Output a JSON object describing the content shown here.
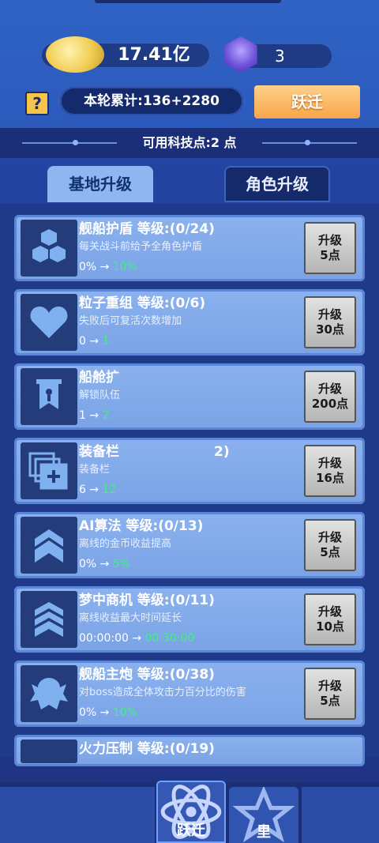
{
  "header": {
    "gold_value": "17.41亿",
    "gem_value": "3",
    "help_icon": "?",
    "round_total": "本轮累计:136+2280",
    "jump_button": "跃迁"
  },
  "tech": {
    "available_points": "可用科技点:2 点"
  },
  "tabs": [
    {
      "label": "基地升级",
      "active": true
    },
    {
      "label": "角色升级",
      "active": false
    }
  ],
  "upgrades": [
    {
      "icon": "hexagon-cluster-icon",
      "title": "舰船护盾  等级:(0/24)",
      "desc": "每关战斗前给予全角色护盾",
      "from": "0%",
      "to": "10%",
      "btn_top": "升级",
      "btn_cost": "5点"
    },
    {
      "icon": "heart-icon",
      "title": "粒子重组  等级:(0/6)",
      "desc": "失败后可复活次数增加",
      "from": "0",
      "to": "1",
      "btn_top": "升级",
      "btn_cost": "30点"
    },
    {
      "icon": "banner-icon",
      "title": "船舱扩",
      "desc": "解锁队伍",
      "from": "1",
      "to": "2",
      "btn_top": "升级",
      "btn_cost": "200点"
    },
    {
      "icon": "stacked-cards-plus-icon",
      "title": "装备栏",
      "title_tail": "2)",
      "desc": "装备栏",
      "from": "6",
      "to": "12",
      "btn_top": "升级",
      "btn_cost": "16点"
    },
    {
      "icon": "double-chevron-icon",
      "title": "AI算法  等级:(0/13)",
      "desc": "离线的金币收益提高",
      "from": "0%",
      "to": "5%",
      "btn_top": "升级",
      "btn_cost": "5点"
    },
    {
      "icon": "triple-chevron-icon",
      "title": "梦中商机  等级:(0/11)",
      "desc": "离线收益最大时间延长",
      "from": "00:00:00",
      "to": "00:30:00",
      "btn_top": "升级",
      "btn_cost": "10点"
    },
    {
      "icon": "beast-icon",
      "title": "舰船主炮  等级:(0/38)",
      "desc": "对boss造成全体攻击力百分比的伤害",
      "from": "0%",
      "to": "10%",
      "btn_top": "升级",
      "btn_cost": "5点"
    },
    {
      "icon": "firepower-icon",
      "title": "火力压制  等级:(0/19)"
    }
  ],
  "arrow": "→",
  "bottom_nav": {
    "active_label": "跃迁",
    "next_label": "里",
    "active_icon": "atom-orbit-icon",
    "next_icon": "star-shield-icon"
  },
  "colors": {
    "accent_green": "#3ff27a",
    "jump_button": "#f8a54b",
    "card": "#8bb2ee"
  }
}
